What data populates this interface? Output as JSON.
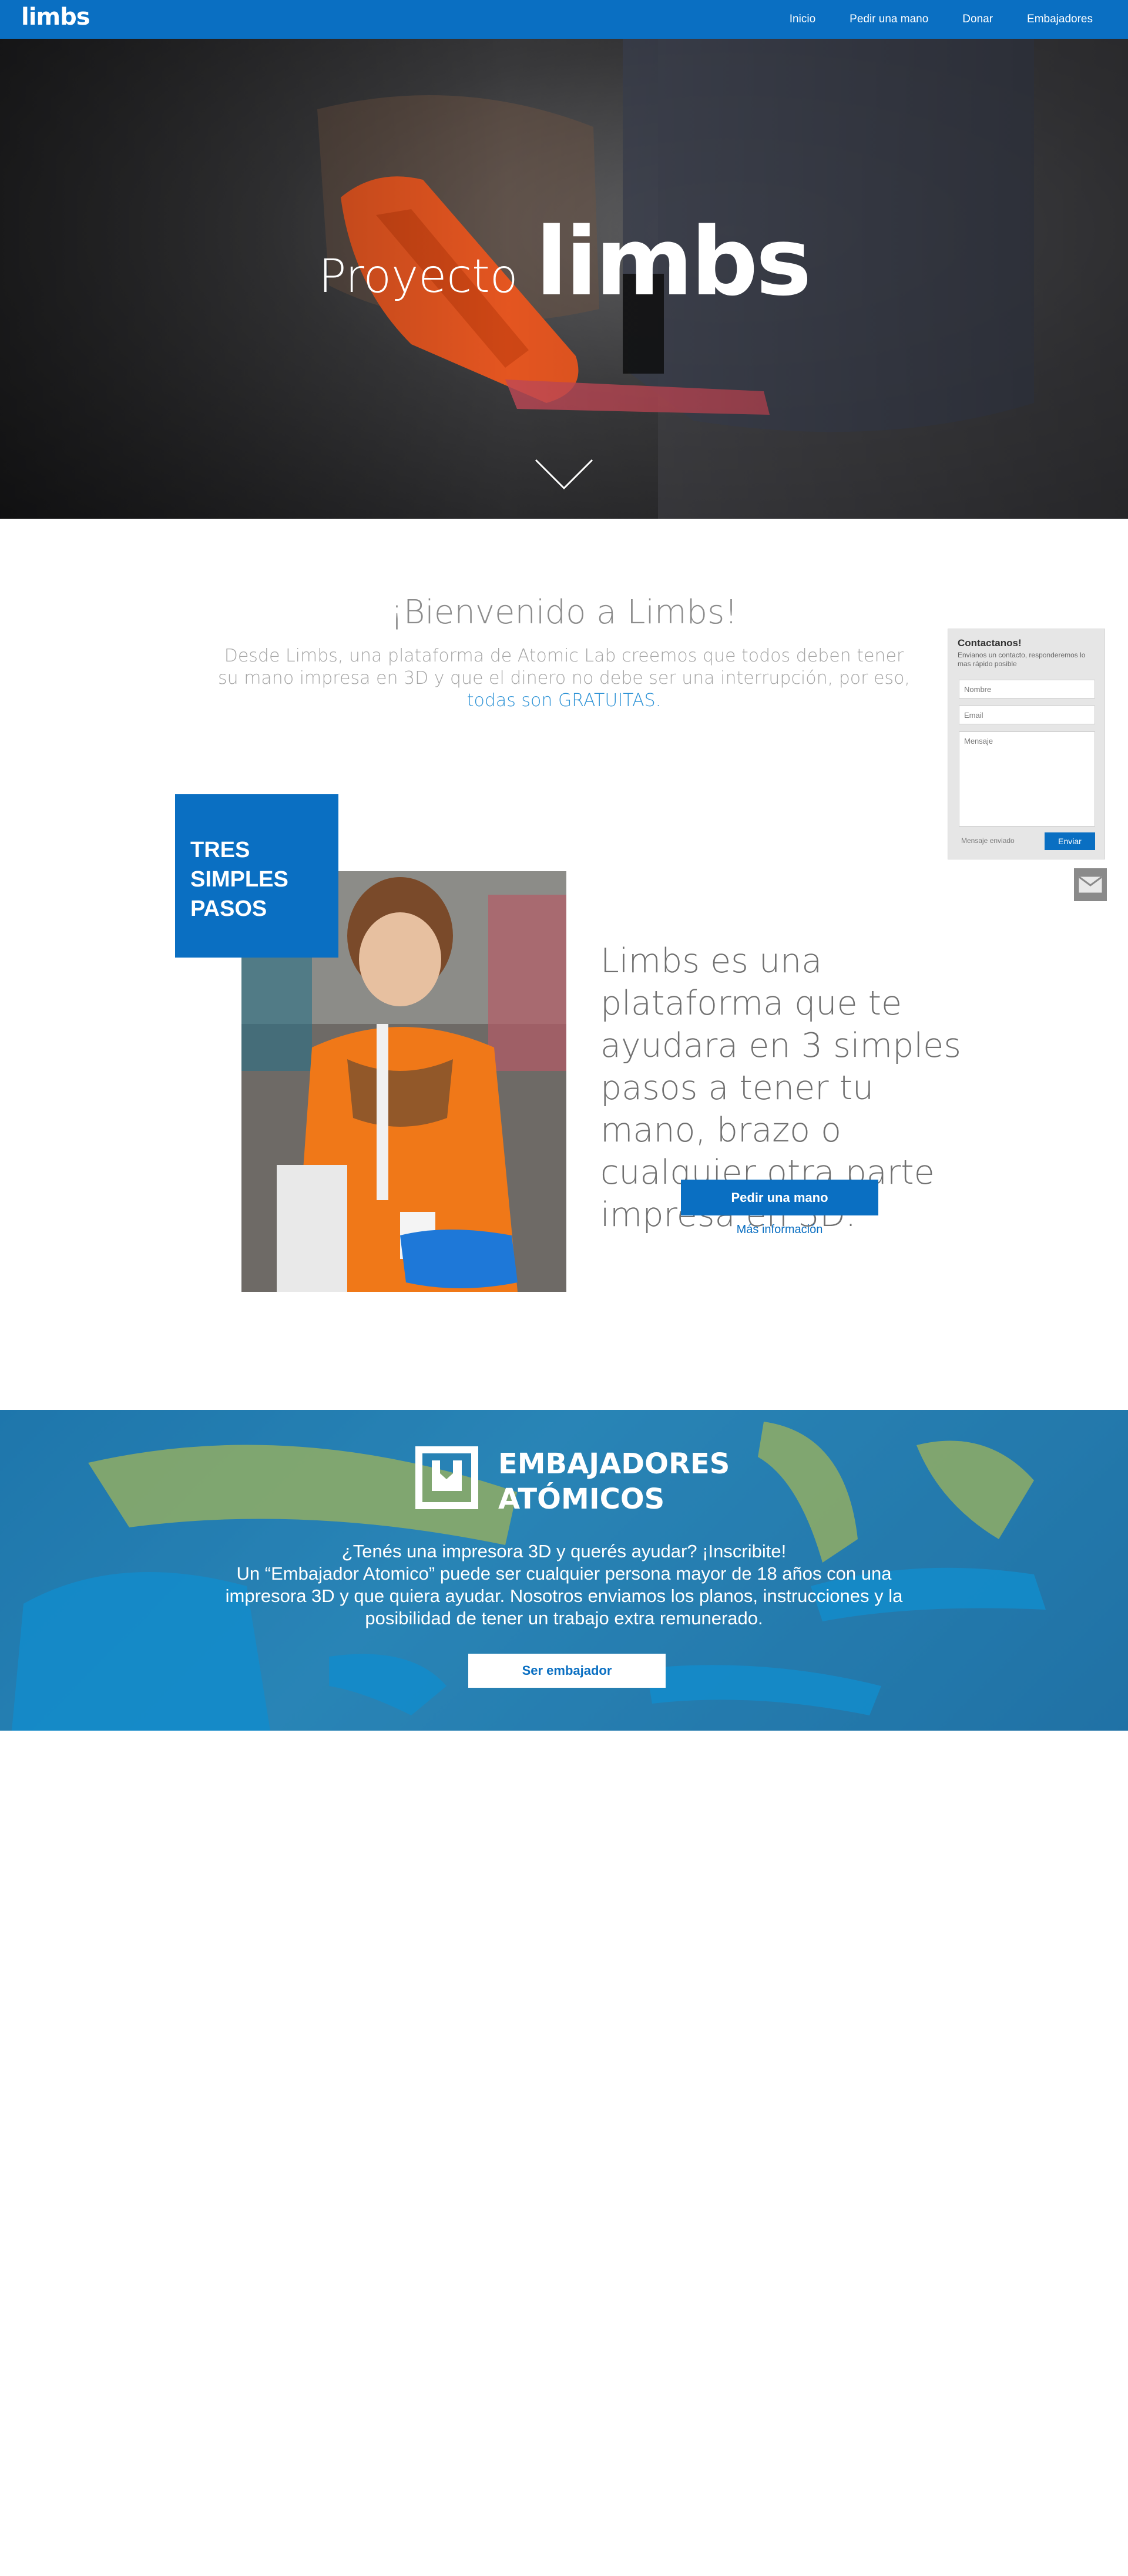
{
  "nav": {
    "logo": "limbs",
    "links": [
      "Inicio",
      "Pedir una mano",
      "Donar",
      "Embajadores"
    ]
  },
  "hero": {
    "proyecto": "Proyecto",
    "brand": "limbs"
  },
  "welcome": {
    "title": "¡Bienvenido a Limbs!",
    "text": "Desde Limbs, una plataforma de Atomic Lab creemos que todos deben tener su mano impresa en 3D y que el dinero no debe ser una interrupción, por eso,",
    "highlight": "todas son GRATUITAS."
  },
  "steps": {
    "box_label": "TRES SIMPLES PASOS",
    "description": "Limbs es una plataforma que te ayudara en 3 simples pasos a tener tu mano, brazo o cualquier otra parte impresa en 3D.",
    "button": "Pedir una mano",
    "more_link": "Más información"
  },
  "contact": {
    "title": "Contactanos!",
    "subtitle": "Envianos un contacto, responderemos lo mas rápido posible",
    "name_placeholder": "Nombre",
    "email_placeholder": "Email",
    "message_placeholder": "Mensaje",
    "status": "Mensaje enviado",
    "send": "Enviar"
  },
  "ambassadors": {
    "title_line1": "EMBAJADORES",
    "title_line2": "ATÓMICOS",
    "text_line1": "¿Tenés una impresora 3D y querés ayudar? ¡Inscribite!",
    "text_line2": "Un “Embajador Atomico” puede ser cualquier persona mayor de 18 años con una impresora 3D y que quiera ayudar. Nosotros enviamos los planos, instrucciones y la posibilidad de tener un trabajo extra remunerado.",
    "button": "Ser embajador"
  },
  "icons": {
    "scroll": "chevron-down-icon",
    "mail": "mail-icon",
    "ambassador_logo": "ambassador-logo-icon"
  },
  "colors": {
    "brand_blue": "#0a6fc2",
    "highlight_blue": "#2e93d6"
  }
}
